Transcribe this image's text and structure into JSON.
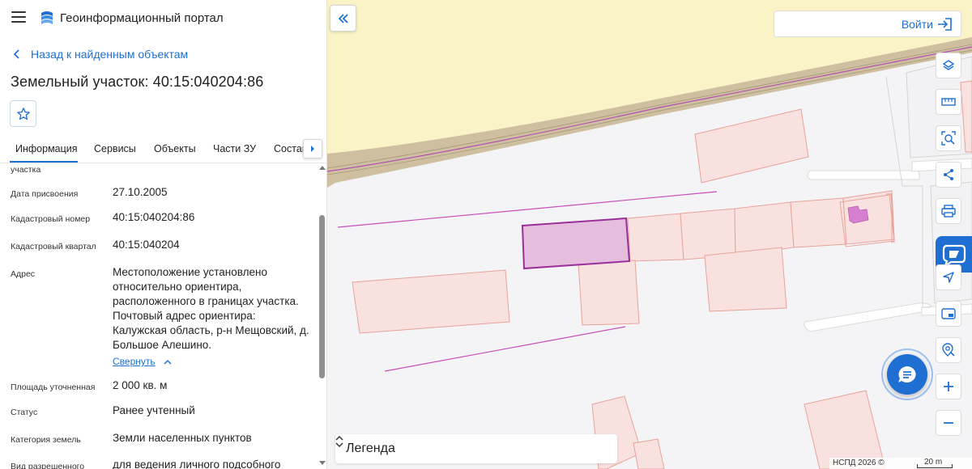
{
  "app": {
    "title": "Геоинформационный портал",
    "back_label": "Назад к найденным объектам",
    "object_title": "Земельный участок: 40:15:040204:86"
  },
  "tabs": [
    {
      "label": "Информация",
      "active": true
    },
    {
      "label": "Сервисы",
      "active": false
    },
    {
      "label": "Объекты",
      "active": false
    },
    {
      "label": "Части ЗУ",
      "active": false
    },
    {
      "label": "Состав",
      "active": false
    }
  ],
  "info": {
    "cut_label": "участка",
    "rows": [
      {
        "label": "Дата присвоения",
        "value": "27.10.2005"
      },
      {
        "label": "Кадастровый номер",
        "value": "40:15:040204:86"
      },
      {
        "label": "Кадастровый квартал",
        "value": "40:15:040204"
      },
      {
        "label": "Адрес",
        "value": "Местоположение установлено относительно ориентира, расположенного в границах участка. Почтовый адрес ориентира: Калужская область, р-н Мещовский, д. Большое Алешино."
      },
      {
        "label": "Площадь уточненная",
        "value": "2 000 кв. м"
      },
      {
        "label": "Статус",
        "value": "Ранее учтенный"
      },
      {
        "label": "Категория земель",
        "value": "Земли населенных пунктов"
      },
      {
        "label": "Вид разрешенного",
        "value": "для ведения личного подсобного"
      }
    ],
    "collapse_label": "Свернуть"
  },
  "map": {
    "login_label": "Войти",
    "legend_label": "Легенда",
    "attribution": "НСПД 2026 ©",
    "scale_label": "20 m",
    "colors": {
      "accent": "#1e6fd1",
      "parcel_fill": "#f9e1df",
      "parcel_stroke": "#e8a39a",
      "selected_fill": "#e6bedd",
      "selected_stroke": "#9a2f9a",
      "road_fill": "#f9f3c6",
      "road_band": "#cdbfa0"
    },
    "tools": [
      "layers-icon",
      "ruler-icon",
      "search-area-icon",
      "share-icon",
      "print-icon",
      "assistant-icon",
      "navigate-icon",
      "card-icon",
      "location-search-icon",
      "zoom-in-icon",
      "zoom-out-icon"
    ]
  }
}
